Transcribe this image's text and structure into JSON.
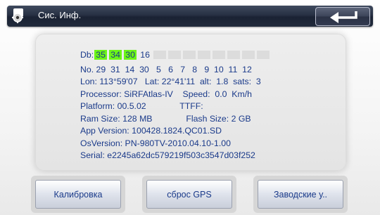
{
  "window": {
    "title": "Сис. Инф."
  },
  "colors": {
    "accent_text": "#1a3a8a",
    "signal_strong": "#6cf516",
    "titlebar": "#222b3d"
  },
  "icons": {
    "settings": "settings-icon",
    "back": "back-arrow-icon"
  },
  "signal": {
    "label": "Db:",
    "values": [
      "35",
      "34",
      "30",
      "16"
    ],
    "strong_count": 3,
    "empty_slots": 8
  },
  "info": {
    "satellites": "No. 29  31  14  30   5   6   7   8   9  10  11  12",
    "position": "Lon: 113°59'07   Lat: 22°41'11  alt:  1.8  sats:  3",
    "processor": "Processor: SiRFAtlas-IV    Speed:  0.0  Km/h",
    "platform": "Platform: 00.5.02              TTFF:",
    "memory": "Ram Size: 128 MB              Flash Size: 2 GB",
    "app_version": "App Version: 100428.1824.QC01.SD",
    "os_version": "OsVersion: PN-980TV-2010.04.10-1.00",
    "serial": "Serial: e2245a62dc579219f503c3547d03f252"
  },
  "buttons": {
    "calibrate": "Калибровка",
    "reset_gps": "сброс GPS",
    "factory": "Заводские у.."
  }
}
